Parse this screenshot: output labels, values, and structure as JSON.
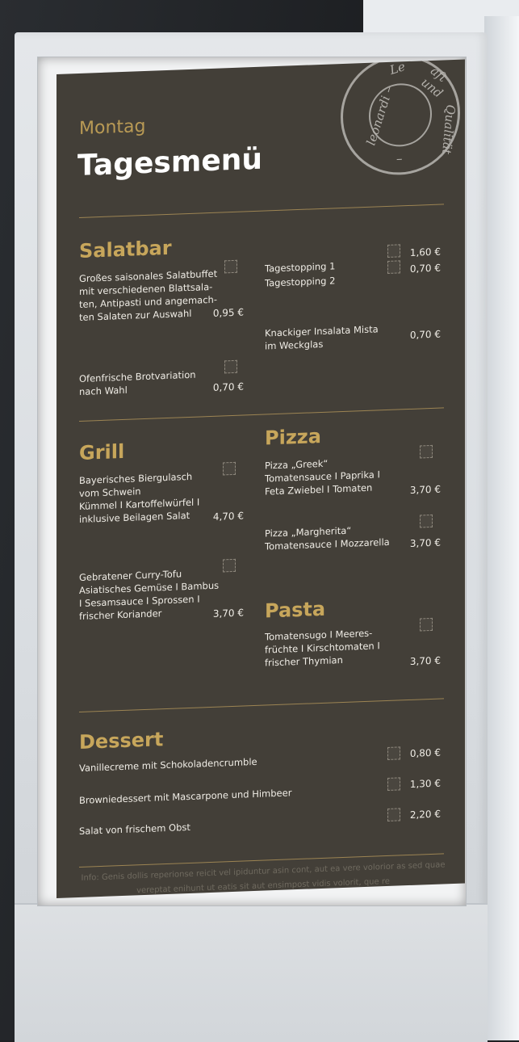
{
  "header": {
    "day": "Montag",
    "title": "Tagesmenü"
  },
  "seal": {
    "text_left": "leonardi –",
    "text_top": "Le",
    "text_right": "aft und",
    "text_right2": "Qualität",
    "text_bottom": "–"
  },
  "salatbar": {
    "title": "Salatbar",
    "items": [
      {
        "name": "Großes saisonales Salatbuffet\nmit verschiedenen Blattsala-\nten, Antipasti und angemach-\nten Salaten zur Auswahl",
        "price": "0,95 €"
      },
      {
        "name": "Ofenfrische Brotvariation\nnach Wahl",
        "price": "0,70 €"
      },
      {
        "name": "Tagestopping 1",
        "price": "1,60 €"
      },
      {
        "name": "Tagestopping 2",
        "price": "0,70 €"
      },
      {
        "name": "Knackiger Insalata Mista\nim Weckglas",
        "price": "0,70 €"
      }
    ]
  },
  "grill": {
    "title": "Grill",
    "items": [
      {
        "name": "Bayerisches Biergulasch\nvom Schwein\nKümmel I Kartoffelwürfel I\ninklusive Beilagen Salat",
        "price": "4,70 €"
      },
      {
        "name": "Gebratener Curry-Tofu\nAsiatisches Gemüse I Bambus\nI Sesamsauce I Sprossen I\nfrischer Koriander",
        "price": "3,70 €"
      }
    ]
  },
  "pizza": {
    "title": "Pizza",
    "items": [
      {
        "name": "Pizza „Greek“\nTomatensauce I Paprika I\nFeta Zwiebel I Tomaten",
        "price": "3,70 €"
      },
      {
        "name": "Pizza „Margherita“\nTomatensauce I Mozzarella",
        "price": "3,70 €"
      }
    ]
  },
  "pasta": {
    "title": "Pasta",
    "items": [
      {
        "name": "Tomatensugo I Meeres-\nfrüchte I Kirschtomaten I\nfrischer Thymian",
        "price": "3,70 €"
      }
    ]
  },
  "dessert": {
    "title": "Dessert",
    "items": [
      {
        "name": "Vanillecreme mit Schokoladencrumble",
        "price": "0,80 €"
      },
      {
        "name": "Browniedessert mit Mascarpone und Himbeer",
        "price": "1,30 €"
      },
      {
        "name": "Salat von frischem Obst",
        "price": "2,20 €"
      }
    ]
  },
  "info": "Info: Genis dollis reperionse reicit vel ipiduntur asin cont, aut ea vere volorior as sed quae vereptat enihunt ut eatis sit aut ensimpost vidis volorit, que re"
}
